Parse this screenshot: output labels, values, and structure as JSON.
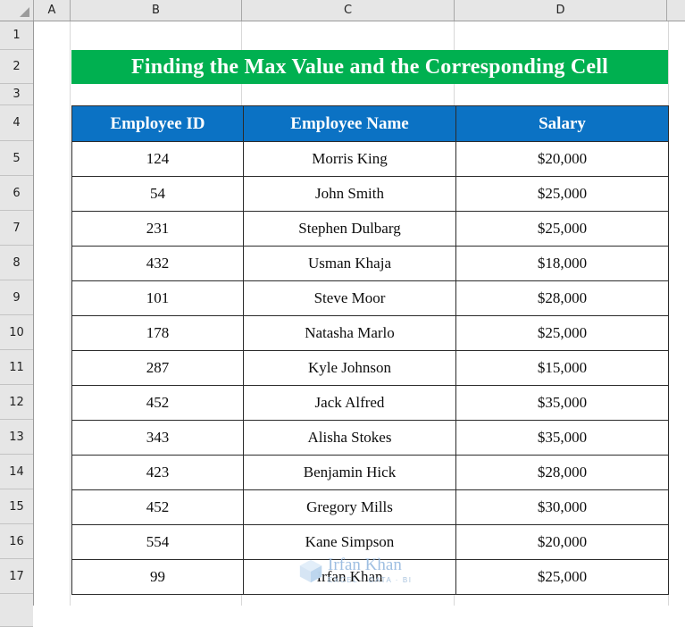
{
  "app": {
    "type": "spreadsheet"
  },
  "grid": {
    "column_headers": [
      "A",
      "B",
      "C",
      "D"
    ],
    "row_headers": [
      "1",
      "2",
      "3",
      "4",
      "5",
      "6",
      "7",
      "8",
      "9",
      "10",
      "11",
      "12",
      "13",
      "14",
      "15",
      "16",
      "17"
    ],
    "select_all_icon": "select-all-triangle-icon"
  },
  "banner": {
    "title": "Finding the Max Value and the Corresponding Cell",
    "background_color": "#00B050",
    "text_color": "#FFFFFF"
  },
  "table": {
    "header_background_color": "#0B72C4",
    "header_text_color": "#FFFFFF",
    "border_color": "#2B2B2B",
    "columns": [
      "Employee ID",
      "Employee Name",
      "Salary"
    ],
    "rows": [
      [
        "124",
        "Morris King",
        "$20,000"
      ],
      [
        "54",
        "John Smith",
        "$25,000"
      ],
      [
        "231",
        "Stephen Dulbarg",
        "$25,000"
      ],
      [
        "432",
        "Usman Khaja",
        "$18,000"
      ],
      [
        "101",
        "Steve Moor",
        "$28,000"
      ],
      [
        "178",
        "Natasha Marlo",
        "$25,000"
      ],
      [
        "287",
        "Kyle Johnson",
        "$15,000"
      ],
      [
        "452",
        "Jack Alfred",
        "$35,000"
      ],
      [
        "343",
        "Alisha Stokes",
        "$35,000"
      ],
      [
        "423",
        "Benjamin Hick",
        "$28,000"
      ],
      [
        "452",
        "Gregory Mills",
        "$30,000"
      ],
      [
        "554",
        "Kane Simpson",
        "$20,000"
      ],
      [
        "99",
        "Irfan Khan",
        "$25,000"
      ]
    ]
  },
  "watermark": {
    "title": "Irfan Khan",
    "subtitle": "EXCEL · DATA · BI",
    "logo_icon": "cube-logo-icon"
  }
}
